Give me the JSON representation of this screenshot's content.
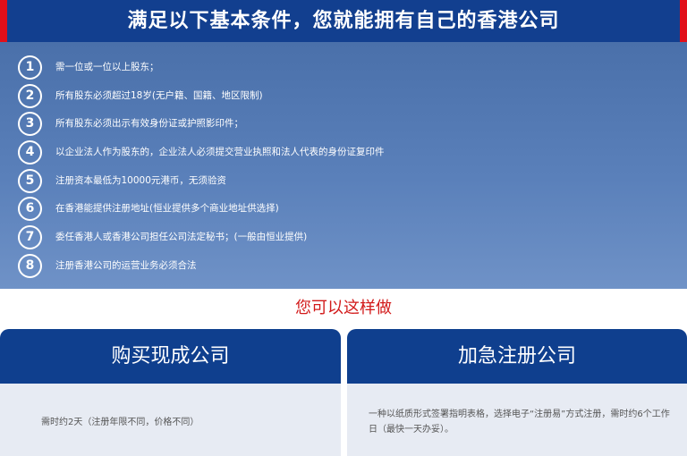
{
  "header": {
    "title": "满足以下基本条件，您就能拥有自己的香港公司"
  },
  "requirements": [
    {
      "number": "1",
      "text": "需一位或一位以上股东；"
    },
    {
      "number": "2",
      "text": "所有股东必须超过18岁(无户籍、国籍、地区限制)"
    },
    {
      "number": "3",
      "text": "所有股东必须出示有效身份证或护照影印件；"
    },
    {
      "number": "4",
      "text": "以企业法人作为股东的，企业法人必须提交营业执照和法人代表的身份证复印件"
    },
    {
      "number": "5",
      "text": "注册资本最低为10000元港币，无须验资"
    },
    {
      "number": "6",
      "text": "在香港能提供注册地址(恒业提供多个商业地址供选择)"
    },
    {
      "number": "7",
      "text": "委任香港人或香港公司担任公司法定秘书；(一般由恒业提供)"
    },
    {
      "number": "8",
      "text": "注册香港公司的运营业务必须合法"
    }
  ],
  "subheading": "您可以这样做",
  "cards": {
    "buy": {
      "title": "购买现成公司",
      "description": "需时约2天（注册年限不同，价格不同）"
    },
    "express": {
      "title": "加急注册公司",
      "description": "一种以纸质形式签署指明表格，选择电子“注册易”方式注册，需时约6个工作日（最快一天办妥）。"
    }
  },
  "colors": {
    "header_bg": "#123f8f",
    "accent_red": "#e10f1a",
    "card_head": "#0f3f8e",
    "subheading": "#d21a1a"
  }
}
